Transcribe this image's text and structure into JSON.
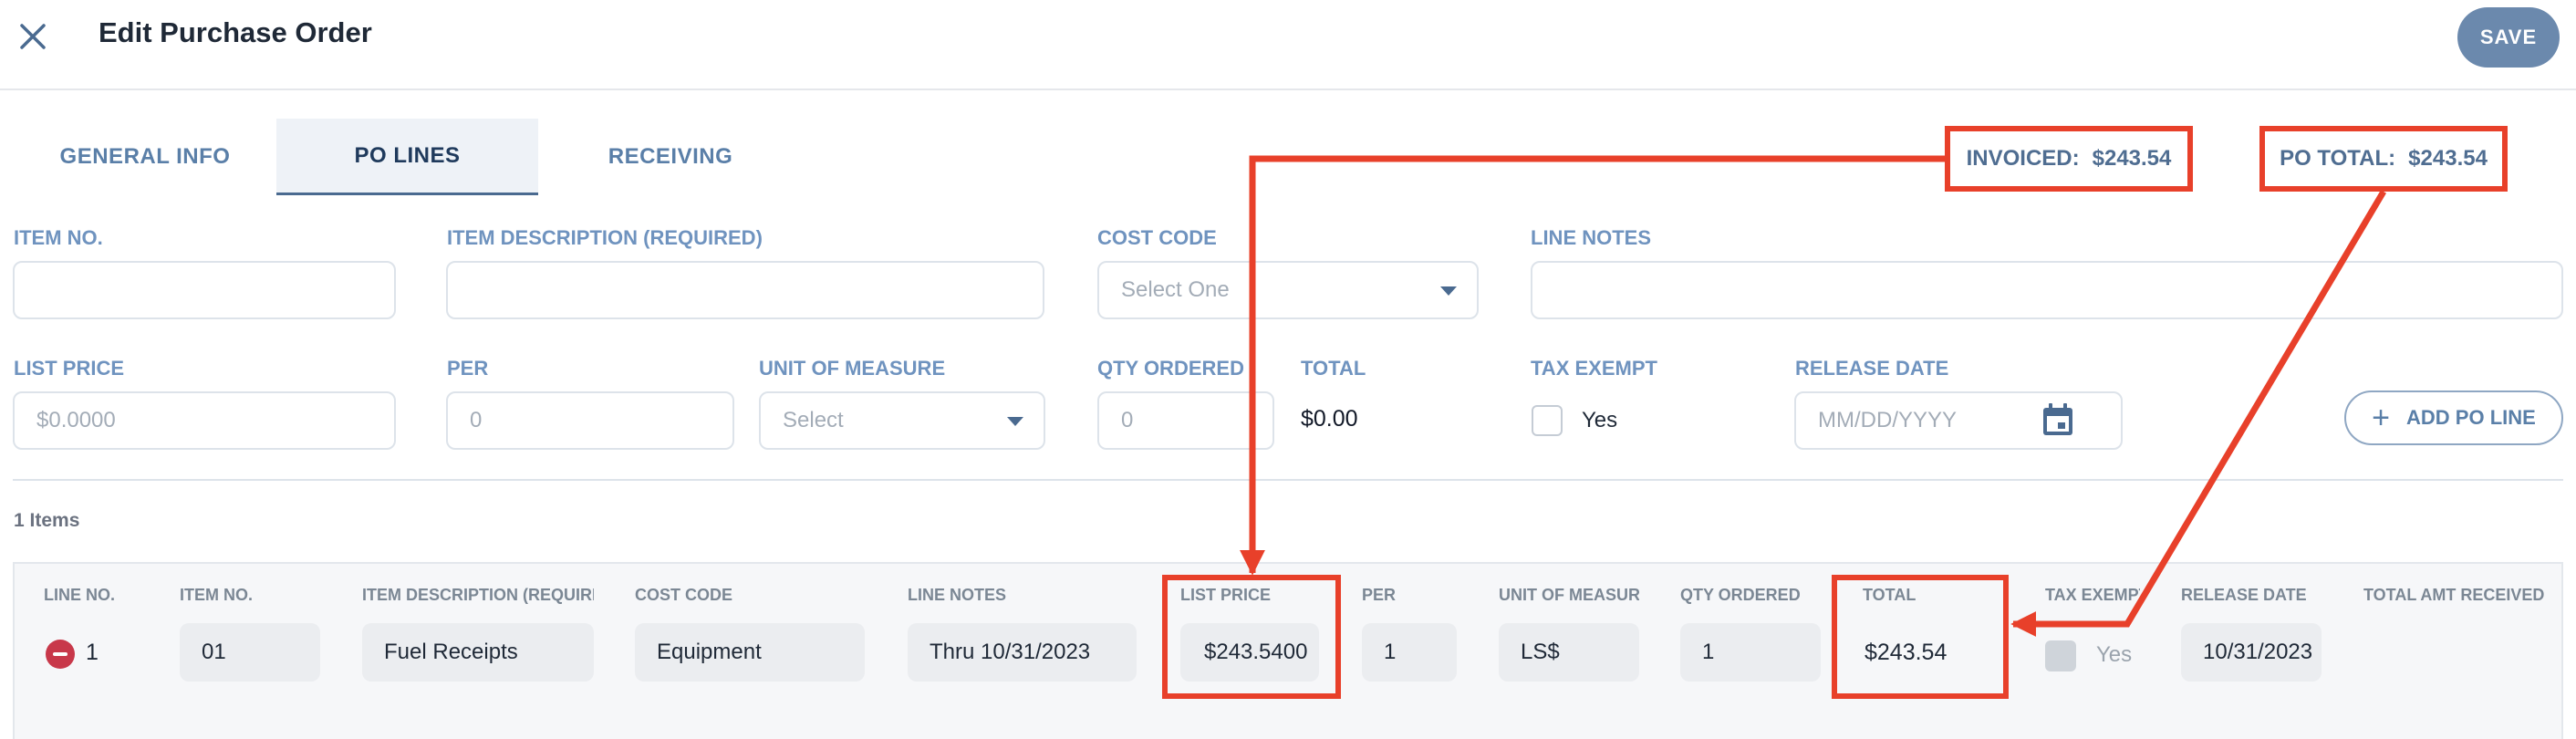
{
  "header": {
    "title": "Edit Purchase Order",
    "save_label": "SAVE"
  },
  "tabs": [
    {
      "label": "GENERAL INFO"
    },
    {
      "label": "PO LINES"
    },
    {
      "label": "RECEIVING"
    }
  ],
  "summary": {
    "invoiced_label": "INVOICED:",
    "invoiced_value": "$243.54",
    "po_total_label": "PO TOTAL:",
    "po_total_value": "$243.54"
  },
  "form": {
    "item_no_label": "ITEM NO.",
    "item_desc_label": "ITEM DESCRIPTION (REQUIRED)",
    "cost_code_label": "COST CODE",
    "cost_code_placeholder": "Select One",
    "line_notes_label": "LINE NOTES",
    "list_price_label": "LIST PRICE",
    "list_price_placeholder": "$0.0000",
    "per_label": "PER",
    "per_placeholder": "0",
    "uom_label": "UNIT OF MEASURE",
    "uom_placeholder": "Select",
    "qty_label": "QTY ORDERED",
    "qty_placeholder": "0",
    "total_label": "TOTAL",
    "total_value": "$0.00",
    "tax_exempt_label": "TAX EXEMPT",
    "tax_exempt_option": "Yes",
    "release_date_label": "RELEASE DATE",
    "release_date_placeholder": "MM/DD/YYYY",
    "add_po_line_label": "ADD PO LINE"
  },
  "table": {
    "items_count": "1 Items",
    "columns": {
      "line_no": "LINE NO.",
      "item_no": "ITEM NO.",
      "item_desc": "ITEM DESCRIPTION (REQUIRI",
      "cost_code": "COST CODE",
      "line_notes": "LINE NOTES",
      "list_price": "LIST PRICE",
      "per": "PER",
      "uom": "UNIT OF MEASUR",
      "qty": "QTY ORDERED",
      "total": "TOTAL",
      "tax_exempt": "TAX EXEMPT",
      "release_date": "RELEASE DATE",
      "total_received": "TOTAL AMT RECEIVED"
    },
    "rows": [
      {
        "line_no": "1",
        "item_no": "01",
        "item_desc": "Fuel Receipts",
        "cost_code": "Equipment",
        "line_notes": "Thru 10/31/2023",
        "list_price": "$243.5400",
        "per": "1",
        "uom": "LS$",
        "qty": "1",
        "total": "$243.54",
        "tax_exempt": "Yes",
        "release_date": "10/31/2023"
      }
    ]
  },
  "colors": {
    "annotation": "#e8402a",
    "accent": "#6b89ad",
    "label": "#6f93bf"
  }
}
